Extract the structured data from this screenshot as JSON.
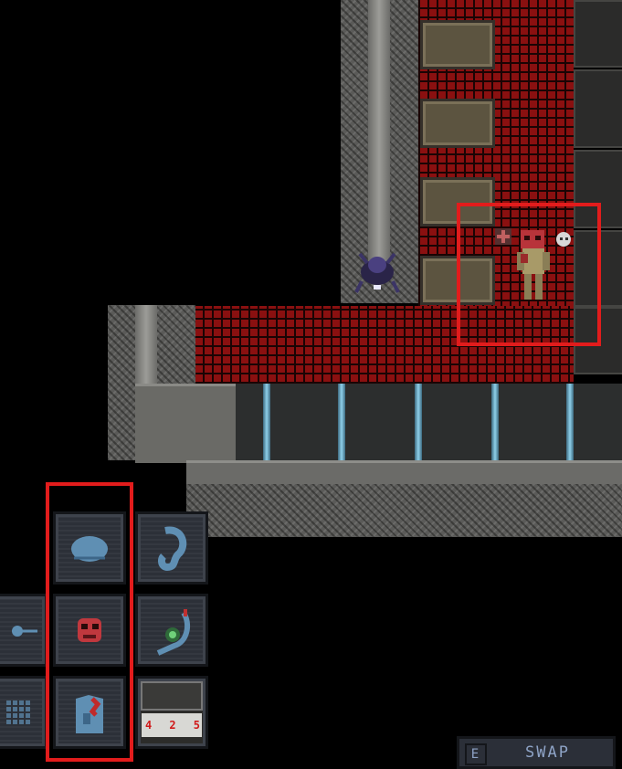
{
  "hud": {
    "swap_key": "E",
    "swap_label": "SWAP"
  },
  "terminal": {
    "digits": [
      "4",
      "2",
      "5"
    ]
  },
  "inventory": {
    "slots": [
      {
        "name": "head-slot",
        "icon": "brain-icon"
      },
      {
        "name": "ear-slot",
        "icon": "ear-icon"
      },
      {
        "name": "left-slot",
        "icon": "wire-icon"
      },
      {
        "name": "mask-slot",
        "icon": "red-mask-icon"
      },
      {
        "name": "radio-slot",
        "icon": "headset-radio-icon"
      },
      {
        "name": "grid-slot",
        "icon": "mesh-icon"
      },
      {
        "name": "suit-slot",
        "icon": "suit-icon"
      },
      {
        "name": "device-slot",
        "icon": "id-device-icon"
      }
    ]
  },
  "colors": {
    "highlight": "#e21c1c",
    "floor_red": "#8a1010",
    "slot_blue": "#5f8fb3"
  }
}
